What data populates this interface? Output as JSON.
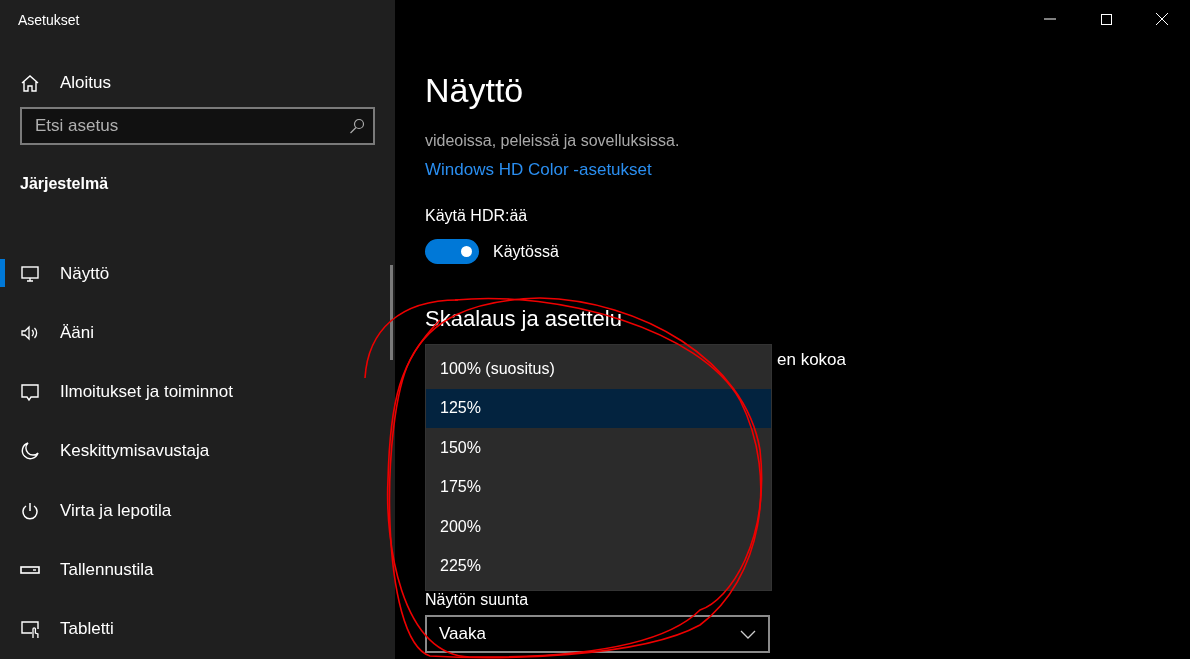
{
  "window": {
    "title": "Asetukset"
  },
  "sidebar": {
    "home": {
      "label": "Aloitus"
    },
    "search": {
      "placeholder": "Etsi asetus"
    },
    "section": "Järjestelmä",
    "items": [
      {
        "label": "Näyttö",
        "selected": true
      },
      {
        "label": "Ääni",
        "selected": false
      },
      {
        "label": "Ilmoitukset ja toiminnot",
        "selected": false
      },
      {
        "label": "Keskittymisavustaja",
        "selected": false
      },
      {
        "label": "Virta ja lepotila",
        "selected": false
      },
      {
        "label": "Tallennustila",
        "selected": false
      },
      {
        "label": "Tabletti",
        "selected": false
      }
    ]
  },
  "main": {
    "title": "Näyttö",
    "description": "videoissa, peleissä ja sovelluksissa.",
    "link": "Windows HD Color -asetukset",
    "hdr": {
      "label": "Käytä HDR:ää",
      "on": true,
      "state_text": "Käytössä"
    },
    "section_title": "Skaalaus ja asettelu",
    "partial_text": "en kokoa",
    "scale_options": [
      {
        "label": "100% (suositus)",
        "selected": false
      },
      {
        "label": "125%",
        "selected": true
      },
      {
        "label": "150%",
        "selected": false
      },
      {
        "label": "175%",
        "selected": false
      },
      {
        "label": "200%",
        "selected": false
      },
      {
        "label": "225%",
        "selected": false
      }
    ],
    "orientation": {
      "label": "Näytön suunta",
      "value": "Vaaka"
    }
  }
}
